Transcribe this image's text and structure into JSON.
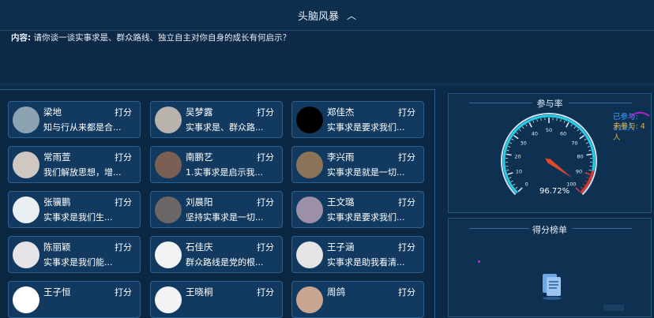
{
  "header": {
    "title": "头脑风暴"
  },
  "content": {
    "label": "内容:",
    "text": "请你谈一谈实事求是、群众路线、独立自主对你自身的成长有何启示？"
  },
  "cards": [
    {
      "name": "梁地",
      "score": "打分",
      "snippet": "知与行从来都是合...",
      "avatar": "#8ba3b3"
    },
    {
      "name": "吴梦露",
      "score": "打分",
      "snippet": "实事求是、群众路...",
      "avatar": "#b9b3ad"
    },
    {
      "name": "郑佳杰",
      "score": "打分",
      "snippet": "实事求是要求我们...",
      "avatar": "#000000"
    },
    {
      "name": "常雨萱",
      "score": "打分",
      "snippet": "我们解放思想，增...",
      "avatar": "#cfc7c2"
    },
    {
      "name": "南鹏艺",
      "score": "打分",
      "snippet": "1.实事求是启示我...",
      "avatar": "#7b5f54"
    },
    {
      "name": "李兴雨",
      "score": "打分",
      "snippet": "实事求是就是一切...",
      "avatar": "#8a7358"
    },
    {
      "name": "张骥鹏",
      "score": "打分",
      "snippet": "实事求是我们生...",
      "avatar": "#e9eef3"
    },
    {
      "name": "刘晨阳",
      "score": "打分",
      "snippet": "坚持实事求是一切...",
      "avatar": "#6d6666"
    },
    {
      "name": "王文璐",
      "score": "打分",
      "snippet": "实事求是要求我们...",
      "avatar": "#9b90a8"
    },
    {
      "name": "陈丽颖",
      "score": "打分",
      "snippet": "实事求是我们能...",
      "avatar": "#e6e3e8"
    },
    {
      "name": "石佳庆",
      "score": "打分",
      "snippet": "群众路线是党的根...",
      "avatar": "#f1f3f5"
    },
    {
      "name": "王子涵",
      "score": "打分",
      "snippet": "实事求是助我看清...",
      "avatar": "#e4e4e4"
    },
    {
      "name": "王子恒",
      "score": "打分",
      "snippet": "",
      "avatar": "#ffffff"
    },
    {
      "name": "王晓桐",
      "score": "打分",
      "snippet": "",
      "avatar": "#f1f3f5"
    },
    {
      "name": "周鸽",
      "score": "打分",
      "snippet": "",
      "avatar": "#c9a58f"
    }
  ],
  "participation": {
    "title": "参与率",
    "percent_text": "96.72%",
    "percent": 96.72,
    "joined": "已参与: 118人",
    "not_joined": "未参与: 4人",
    "joined_color": "#3aa0ff",
    "not_joined_color": "#e0b24a",
    "ticks": [
      "0",
      "10",
      "20",
      "30",
      "40",
      "50",
      "60",
      "70",
      "80",
      "90",
      "100"
    ]
  },
  "ranking": {
    "title": "得分榜单"
  },
  "colors": {
    "accent": "#2c608f",
    "needle": "#e04a2a",
    "gauge_red": "#e03a2a"
  }
}
